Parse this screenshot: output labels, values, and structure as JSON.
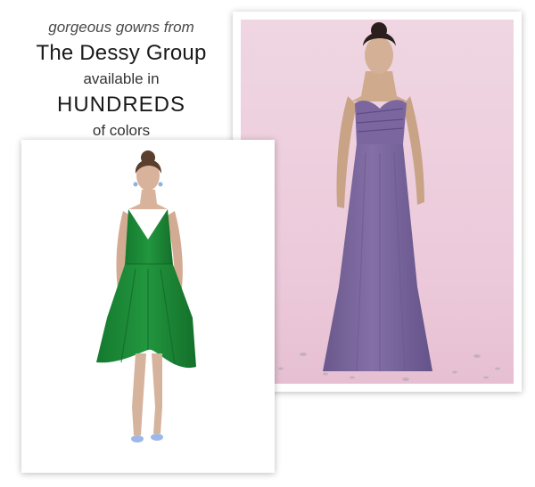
{
  "headline": {
    "line1": "gorgeous gowns from",
    "line2": "The Dessy Group",
    "line3": "available in",
    "line4": "HUNDREDS",
    "line5": "of colors"
  },
  "colors": {
    "green_dress": "#1f8a3a",
    "purple_gown": "#7a679c",
    "pink_backdrop": "#efcfdf"
  },
  "images": {
    "left": "green-short-dress-photo",
    "right": "purple-strapless-gown-photo"
  }
}
